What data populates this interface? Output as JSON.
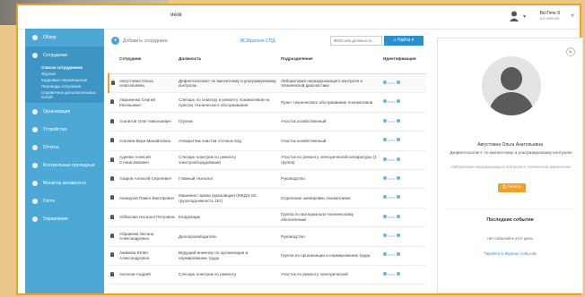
{
  "topbar": {
    "title": "иков",
    "brand": "BioTime 8",
    "brand_sub": "8.0.0000.85",
    "collapse": "«"
  },
  "sidebar": {
    "items": [
      {
        "label": "Обзор",
        "icon": "dashboard-icon"
      },
      {
        "label": "Сотрудники",
        "icon": "users-icon",
        "active": true
      },
      {
        "label": "Организация",
        "icon": "org-icon"
      },
      {
        "label": "Устройства",
        "icon": "device-icon"
      },
      {
        "label": "Отчёты",
        "icon": "report-icon"
      },
      {
        "label": "Контрольные проходные",
        "icon": "gate-icon"
      },
      {
        "label": "Монитор активности",
        "icon": "monitor-icon"
      },
      {
        "label": "Гости",
        "icon": "guest-icon"
      },
      {
        "label": "Управление",
        "icon": "settings-icon"
      }
    ],
    "subitems": [
      {
        "label": "Список сотрудников",
        "selected": true
      },
      {
        "label": "Журнал"
      },
      {
        "label": "Кадровые перемещения"
      },
      {
        "label": "Переводы отпусками"
      },
      {
        "label": "Справочник дополнительных полей"
      }
    ]
  },
  "toolbar": {
    "add_label": "Добавить сотрудника",
    "crumb": "ВС/Краткое СПД",
    "search_placeholder": "ФИО или должность",
    "find_label": "Найти"
  },
  "table": {
    "headers": [
      "Сотрудник",
      "Должность",
      "Подразделение",
      "Идентификация"
    ],
    "rows": [
      [
        "Августовна Ольга Анатольевна",
        "Дефектоскопист по магнитному и ультразвуковому контролю",
        "Лаборатория неразрушающего контроля и технической диагностики"
      ],
      [
        "Авраменко Сергей Евгеньевич",
        "Слесарь по осмотру и ремонту локомотивов на пунктах технического обслуживания",
        "Пункт технического обслуживания локомотивов"
      ],
      [
        "Агапитов Олег Николаевич",
        "Грузчик",
        "Участок хозяйственный"
      ],
      [
        "Агапова Вера Михайловна",
        "Аппаратчик очистки сточных вод",
        "Участок хозяйственный"
      ],
      [
        "Адеева Алексей Станиславович",
        "Слесарь-электрик по ремонту электрооборудования",
        "Участок по ремонту электрической аппаратуры (1 группа)"
      ],
      [
        "Азаров Алексей Сергеевич",
        "Главный технолог",
        "Руководство"
      ],
      [
        "Акимуров Павел Викторович",
        "Машинист крана (крановщик) (КЖДЭ-16, грузоподъемность 16т)",
        "Отделение экипировки локомотивов"
      ],
      [
        "Аббасова Наталья Петровна",
        "Кладовщик",
        "Группа по материально-техническому обеспечению"
      ],
      [
        "Абрамова Оксана Александровна",
        "Делопроизводитель",
        "Руководство"
      ],
      [
        "Акимова Юлия Александровна",
        "Ведущий инженер по организации и нормированию труда",
        "Группа по организации и нормированию труда"
      ],
      [
        "Аксенов Андрей",
        "Слесарь-электрик по ремонту",
        "Участок по ремонту электрической"
      ]
    ]
  },
  "profile": {
    "name": "Августовна Ольга Анатольевна",
    "position": "Дефектоскопист по магнитному и ультразвуковому контролю",
    "department": "Лаборатория неразрушающего контроля и технической диагностики",
    "print_label": "Печать",
    "events_title": "Последние события",
    "no_events": "нет событий в этот день",
    "journal_link": "Перейти в Журнал событий"
  }
}
